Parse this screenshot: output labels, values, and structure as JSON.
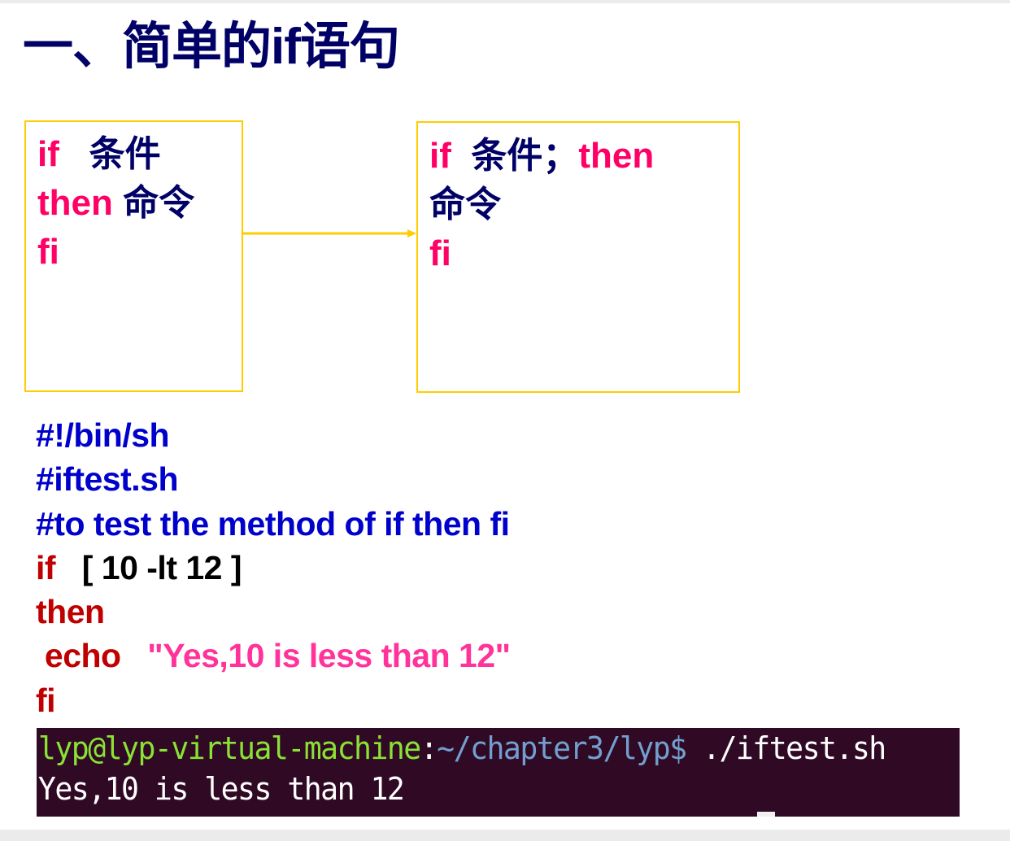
{
  "slide": {
    "title": "一、简单的if语句"
  },
  "syntax_boxes": {
    "left": {
      "lines": [
        {
          "kw": "if",
          "sep": "   ",
          "text": "条件"
        },
        {
          "kw": "then",
          "sep": " ",
          "text": "命令"
        },
        {
          "kw": "fi",
          "sep": "",
          "text": ""
        }
      ]
    },
    "right": {
      "line1_kw": "if",
      "line1_sep": "  ",
      "line1_text": "条件；",
      "line1_kw2": "then",
      "line2_text": "命令",
      "line3_kw": "fi"
    },
    "arrow": "arrow-right"
  },
  "script": {
    "shebang": "#!/bin/sh",
    "filename_comment": "#iftest.sh",
    "purpose_comment": "#to test the method of if then fi",
    "if_kw": "if",
    "if_sep": "   ",
    "condition": "[ 10 -lt 12 ]",
    "then_kw": "then",
    "echo_indent": " ",
    "echo_kw": "echo",
    "echo_sep": "   ",
    "echo_arg": "\"Yes,10 is less than 12\"",
    "fi_kw": "fi"
  },
  "terminal": {
    "user_host": "lyp@lyp-virtual-machine",
    "colon": ":",
    "path": "~/chapter3/lyp$",
    "command": " ./iftest.sh",
    "output": "Yes,10 is less than 12"
  },
  "colors": {
    "title": "#000066",
    "keyword_box": "#ff0066",
    "chinese_text": "#000066",
    "box_border": "#ffcc00",
    "comment": "#0000cc",
    "script_keyword": "#c00000",
    "string": "#ff3399",
    "terminal_bg": "#300a24",
    "terminal_user": "#8ae234",
    "terminal_path": "#729fcf"
  }
}
